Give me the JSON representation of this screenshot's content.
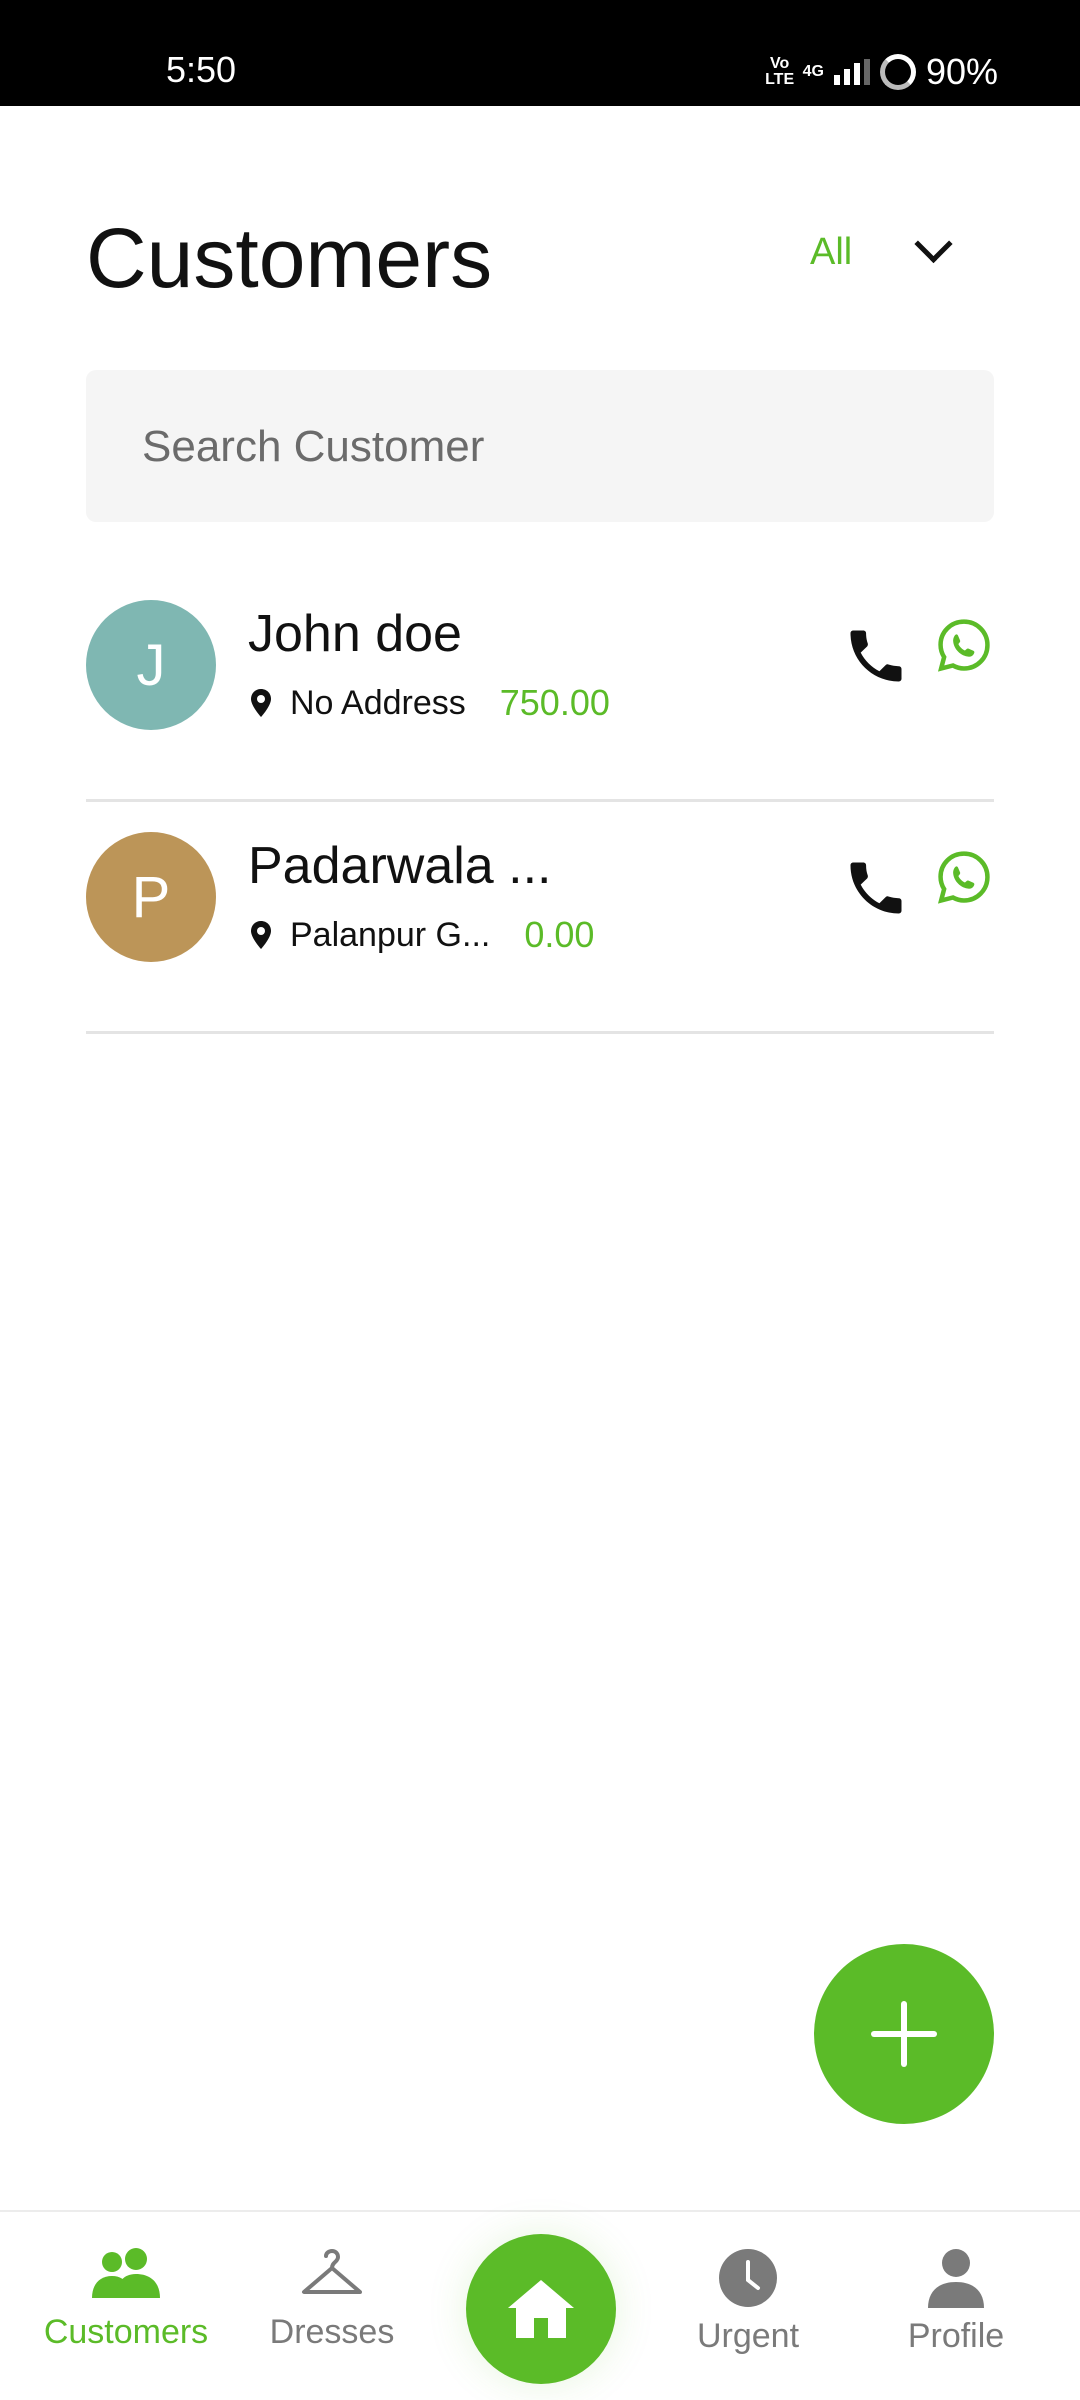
{
  "status_bar": {
    "time": "5:50",
    "volte_top": "Vo",
    "volte_bottom": "LTE",
    "network": "4G",
    "battery": "90%"
  },
  "header": {
    "title": "Customers",
    "filter_value": "All"
  },
  "search": {
    "placeholder": "Search Customer"
  },
  "customers": [
    {
      "initial": "J",
      "name": "John doe",
      "address": "No Address",
      "amount": "750.00",
      "avatar_color": "#7fb7b2"
    },
    {
      "initial": "P",
      "name": "Padarwala ...",
      "address": "Palanpur G...",
      "amount": "0.00",
      "avatar_color": "#bc9558"
    }
  ],
  "nav": {
    "items": [
      {
        "label": "Customers",
        "icon": "people-icon",
        "active": true
      },
      {
        "label": "Dresses",
        "icon": "hanger-icon",
        "active": false
      },
      {
        "label": "Home",
        "icon": "home-icon",
        "active": false
      },
      {
        "label": "Urgent",
        "icon": "clock-icon",
        "active": false
      },
      {
        "label": "Profile",
        "icon": "person-icon",
        "active": false
      }
    ]
  },
  "colors": {
    "accent": "#5bbb28",
    "text": "#111111",
    "muted": "#7a7a7a",
    "search_bg": "#f5f5f5"
  }
}
